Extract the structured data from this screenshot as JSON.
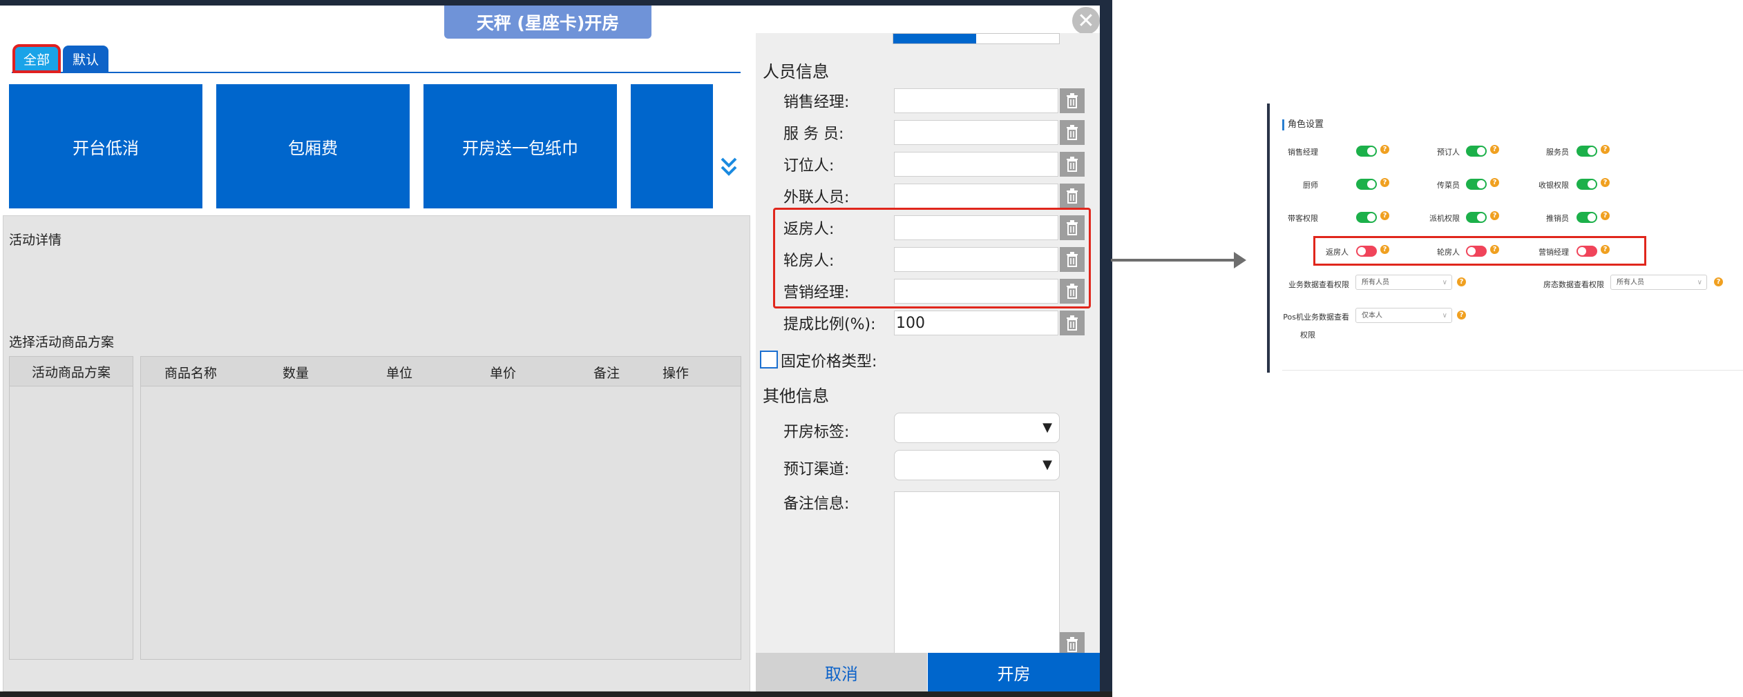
{
  "dialog": {
    "title": "天秤 (星座卡)开房",
    "close_icon": "close-icon"
  },
  "tabs": [
    {
      "label": "全部",
      "active": true
    },
    {
      "label": "默认",
      "active": false
    }
  ],
  "activities": [
    {
      "label": "开台低消"
    },
    {
      "label": "包厢费"
    },
    {
      "label": "开房送一包纸巾"
    }
  ],
  "activity_detail": {
    "label": "活动详情",
    "select_plan_label": "选择活动商品方案",
    "plan_column": "活动商品方案",
    "columns": [
      "商品名称",
      "数量",
      "单位",
      "单价",
      "备注",
      "操作"
    ]
  },
  "personnel": {
    "title": "人员信息",
    "fields": [
      {
        "label": "销售经理:",
        "value": ""
      },
      {
        "label": "服 务 员:",
        "value": ""
      },
      {
        "label": "订位人:",
        "value": ""
      },
      {
        "label": "外联人员:",
        "value": ""
      },
      {
        "label": "返房人:",
        "value": ""
      },
      {
        "label": "轮房人:",
        "value": ""
      },
      {
        "label": "营销经理:",
        "value": ""
      },
      {
        "label": "提成比例(%):",
        "value": "100"
      }
    ],
    "fixed_price_label": "固定价格类型:"
  },
  "other": {
    "title": "其他信息",
    "tag_label": "开房标签:",
    "channel_label": "预订渠道:",
    "remark_label": "备注信息:"
  },
  "buttons": {
    "cancel": "取消",
    "open": "开房"
  },
  "role_settings": {
    "title": "角色设置",
    "toggles": [
      {
        "label": "销售经理",
        "state": "on"
      },
      {
        "label": "预订人",
        "state": "on"
      },
      {
        "label": "服务员",
        "state": "on"
      },
      {
        "label": "厨师",
        "state": "on"
      },
      {
        "label": "传菜员",
        "state": "on"
      },
      {
        "label": "收银权限",
        "state": "on"
      },
      {
        "label": "带客权限",
        "state": "on"
      },
      {
        "label": "派机权限",
        "state": "on"
      },
      {
        "label": "推销员",
        "state": "on"
      },
      {
        "label": "返房人",
        "state": "off"
      },
      {
        "label": "轮房人",
        "state": "off"
      },
      {
        "label": "营销经理",
        "state": "off"
      }
    ],
    "business_view_label": "业务数据查看权限",
    "business_view_value": "所有人员",
    "room_view_label": "房态数据查看权限",
    "room_view_value": "所有人员",
    "pos_view_label_1": "Pos机业务数据查看",
    "pos_view_label_2": "权限",
    "pos_view_value": "仅本人"
  },
  "colors": {
    "primary": "#0066cc",
    "highlight": "#e0261c",
    "toggle_on": "#1cb04a",
    "toggle_off": "#f0445a"
  }
}
